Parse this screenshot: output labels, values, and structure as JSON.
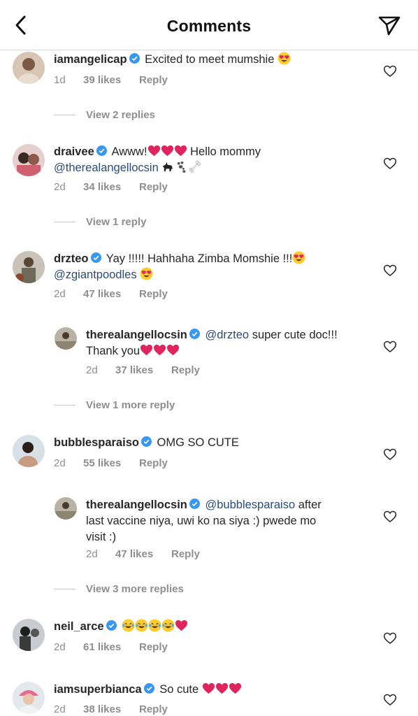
{
  "header": {
    "title": "Comments",
    "back_icon": "chevron-left-icon",
    "share_icon": "paper-plane-icon"
  },
  "comments": [
    {
      "username": "iamangelicap",
      "text_before": "Excited to meet mumshie",
      "time": "1d",
      "likes": "39 likes",
      "reply": "Reply",
      "view_replies": "View 2 replies"
    },
    {
      "username": "draivee",
      "text_before": "Awww!",
      "text_after": "Hello mommy",
      "mention": "@therealangellocsin",
      "time": "2d",
      "likes": "34 likes",
      "reply": "Reply",
      "view_replies": "View 1 reply"
    },
    {
      "username": "drzteo",
      "text_before": "Yay !!!!! Hahhaha Zimba Momshie !!!",
      "mention": "@zgiantpoodles",
      "time": "2d",
      "likes": "47 likes",
      "reply": "Reply"
    },
    {
      "username": "therealangellocsin",
      "mention": "@drzteo",
      "text_after": "super cute doc!!!",
      "text_line2": "Thank you",
      "time": "2d",
      "likes": "37 likes",
      "reply": "Reply",
      "view_replies": "View 1 more reply"
    },
    {
      "username": "bubblesparaiso",
      "text_before": "OMG SO CUTE",
      "time": "2d",
      "likes": "55 likes",
      "reply": "Reply"
    },
    {
      "username": "therealangellocsin",
      "mention": "@bubblesparaiso",
      "text_after": "after",
      "text_line2": "last vaccine niya, uwi ko na siya :) pwede mo",
      "text_line3": "visit :)",
      "time": "2d",
      "likes": "47 likes",
      "reply": "Reply",
      "view_replies": "View 3 more replies"
    },
    {
      "username": "neil_arce",
      "time": "2d",
      "likes": "61 likes",
      "reply": "Reply"
    },
    {
      "username": "iamsuperbianca",
      "text_before": "So cute",
      "time": "2d",
      "likes": "38 likes",
      "reply": "Reply"
    }
  ],
  "colors": {
    "verified": "#3897f0",
    "mention": "#2a4b7c",
    "meta": "#8e8e8e",
    "heart_emoji": "#e0245e"
  }
}
